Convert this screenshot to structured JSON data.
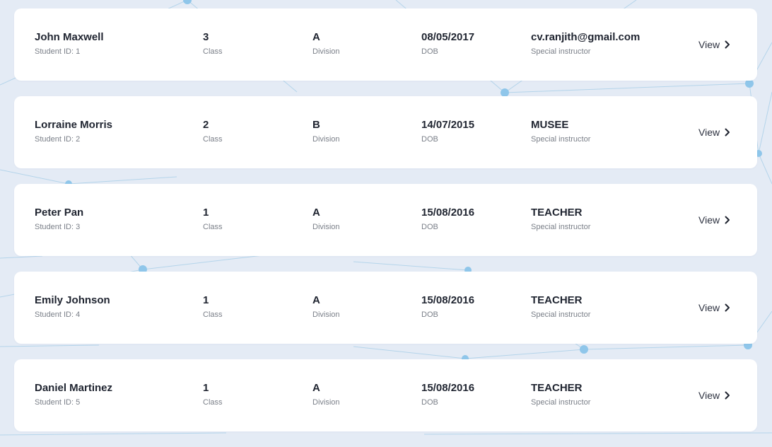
{
  "students": [
    {
      "name": "John Maxwell",
      "student_id": "Student ID: 1",
      "class_value": "3",
      "class_label": "Class",
      "division_value": "A",
      "division_label": "Division",
      "dob_value": "08/05/2017",
      "dob_label": "DOB",
      "instructor_value": "cv.ranjith@gmail.com",
      "instructor_label": "Special instructor",
      "view_label": "View"
    },
    {
      "name": "Lorraine Morris",
      "student_id": "Student ID: 2",
      "class_value": "2",
      "class_label": "Class",
      "division_value": "B",
      "division_label": "Division",
      "dob_value": "14/07/2015",
      "dob_label": "DOB",
      "instructor_value": "MUSEE",
      "instructor_label": "Special instructor",
      "view_label": "View"
    },
    {
      "name": "Peter Pan",
      "student_id": "Student ID: 3",
      "class_value": "1",
      "class_label": "Class",
      "division_value": "A",
      "division_label": "Division",
      "dob_value": "15/08/2016",
      "dob_label": "DOB",
      "instructor_value": "TEACHER",
      "instructor_label": "Special instructor",
      "view_label": "View"
    },
    {
      "name": "Emily Johnson",
      "student_id": "Student ID: 4",
      "class_value": "1",
      "class_label": "Class",
      "division_value": "A",
      "division_label": "Division",
      "dob_value": "15/08/2016",
      "dob_label": "DOB",
      "instructor_value": "TEACHER",
      "instructor_label": "Special instructor",
      "view_label": "View"
    },
    {
      "name": "Daniel Martinez",
      "student_id": "Student ID: 5",
      "class_value": "1",
      "class_label": "Class",
      "division_value": "A",
      "division_label": "Division",
      "dob_value": "15/08/2016",
      "dob_label": "DOB",
      "instructor_value": "TEACHER",
      "instructor_label": "Special instructor",
      "view_label": "View"
    }
  ],
  "icons": {
    "view": "chevron-right-icon"
  },
  "colors": {
    "background": "#e4ebf5",
    "card": "#ffffff",
    "network_line": "#a9cfe8",
    "network_node": "#8fc6ea",
    "text_primary": "#1f2430",
    "text_secondary": "#7a7f88"
  }
}
